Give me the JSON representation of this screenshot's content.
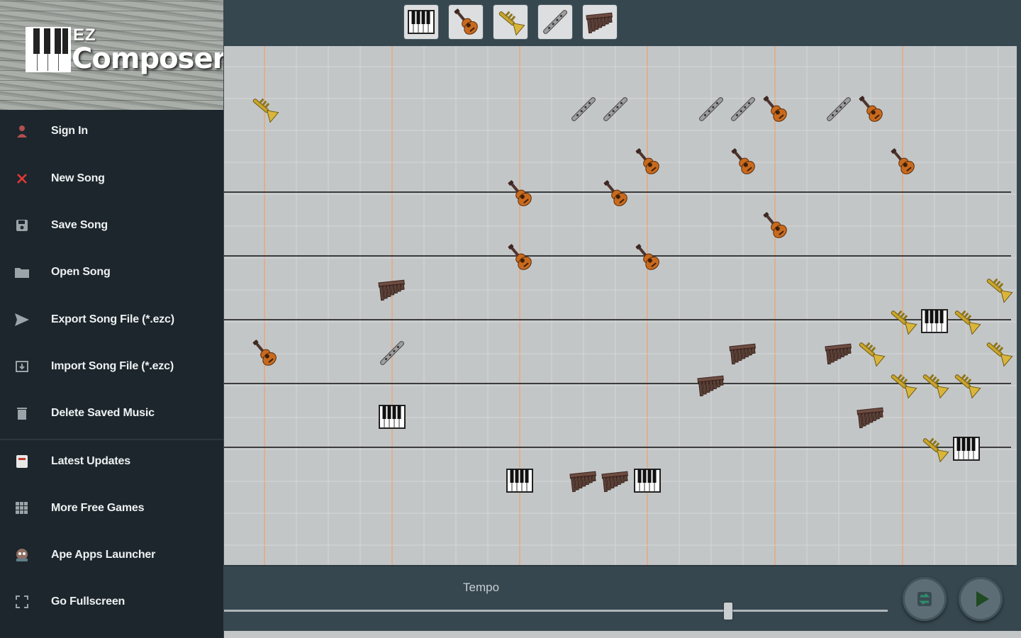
{
  "app": {
    "logo_ez": "EZ",
    "logo_title": "Composer"
  },
  "drawer": {
    "items": [
      {
        "label": "Sign In",
        "icon": "user-icon"
      },
      {
        "label": "New Song",
        "icon": "close-icon"
      },
      {
        "label": "Save Song",
        "icon": "save-icon"
      },
      {
        "label": "Open Song",
        "icon": "folder-icon"
      },
      {
        "label": "Export Song File (*.ezc)",
        "icon": "send-icon"
      },
      {
        "label": "Import Song File (*.ezc)",
        "icon": "import-icon"
      },
      {
        "label": "Delete Saved Music",
        "icon": "trash-icon"
      },
      {
        "label": "Latest Updates",
        "icon": "updates-icon"
      },
      {
        "label": "More Free Games",
        "icon": "grid-icon"
      },
      {
        "label": "Ape Apps Launcher",
        "icon": "launcher-icon"
      },
      {
        "label": "Go Fullscreen",
        "icon": "fullscreen-icon"
      }
    ]
  },
  "toolbar": {
    "instruments": [
      "piano",
      "guitar",
      "trumpet",
      "flute",
      "panflute"
    ],
    "selected": "piano"
  },
  "composition": {
    "notes": [
      {
        "instrument": "trumpet",
        "beat": 0,
        "pitch": 3
      },
      {
        "instrument": "flute",
        "beat": 10,
        "pitch": 3
      },
      {
        "instrument": "flute",
        "beat": 11,
        "pitch": 3
      },
      {
        "instrument": "flute",
        "beat": 14,
        "pitch": 3
      },
      {
        "instrument": "flute",
        "beat": 15,
        "pitch": 3
      },
      {
        "instrument": "guitar",
        "beat": 16,
        "pitch": 3
      },
      {
        "instrument": "flute",
        "beat": 18,
        "pitch": 3
      },
      {
        "instrument": "guitar",
        "beat": 19,
        "pitch": 3
      },
      {
        "instrument": "guitar",
        "beat": 12,
        "pitch": 4
      },
      {
        "instrument": "guitar",
        "beat": 15,
        "pitch": 4
      },
      {
        "instrument": "guitar",
        "beat": 20,
        "pitch": 4
      },
      {
        "instrument": "guitar",
        "beat": 8,
        "pitch": 5
      },
      {
        "instrument": "guitar",
        "beat": 11,
        "pitch": 5
      },
      {
        "instrument": "guitar",
        "beat": 16,
        "pitch": 6
      },
      {
        "instrument": "guitar",
        "beat": 8,
        "pitch": 7
      },
      {
        "instrument": "guitar",
        "beat": 12,
        "pitch": 7
      },
      {
        "instrument": "panflute",
        "beat": 4,
        "pitch": 8
      },
      {
        "instrument": "trumpet",
        "beat": 23,
        "pitch": 8
      },
      {
        "instrument": "trumpet",
        "beat": 20,
        "pitch": 9
      },
      {
        "instrument": "piano",
        "beat": 21,
        "pitch": 9
      },
      {
        "instrument": "trumpet",
        "beat": 22,
        "pitch": 9
      },
      {
        "instrument": "guitar",
        "beat": 0,
        "pitch": 10
      },
      {
        "instrument": "flute",
        "beat": 4,
        "pitch": 10
      },
      {
        "instrument": "panflute",
        "beat": 15,
        "pitch": 10
      },
      {
        "instrument": "panflute",
        "beat": 18,
        "pitch": 10
      },
      {
        "instrument": "trumpet",
        "beat": 19,
        "pitch": 10
      },
      {
        "instrument": "trumpet",
        "beat": 23,
        "pitch": 10
      },
      {
        "instrument": "panflute",
        "beat": 14,
        "pitch": 11
      },
      {
        "instrument": "trumpet",
        "beat": 20,
        "pitch": 11
      },
      {
        "instrument": "trumpet",
        "beat": 21,
        "pitch": 11
      },
      {
        "instrument": "trumpet",
        "beat": 22,
        "pitch": 11
      },
      {
        "instrument": "piano",
        "beat": 4,
        "pitch": 12
      },
      {
        "instrument": "panflute",
        "beat": 19,
        "pitch": 12
      },
      {
        "instrument": "trumpet",
        "beat": 21,
        "pitch": 13
      },
      {
        "instrument": "piano",
        "beat": 22,
        "pitch": 13
      },
      {
        "instrument": "piano",
        "beat": 8,
        "pitch": 14
      },
      {
        "instrument": "panflute",
        "beat": 10,
        "pitch": 14
      },
      {
        "instrument": "panflute",
        "beat": 11,
        "pitch": 14
      },
      {
        "instrument": "piano",
        "beat": 12,
        "pitch": 14
      }
    ]
  },
  "playback": {
    "tempo_label": "Tempo",
    "tempo_value": 0.76
  }
}
